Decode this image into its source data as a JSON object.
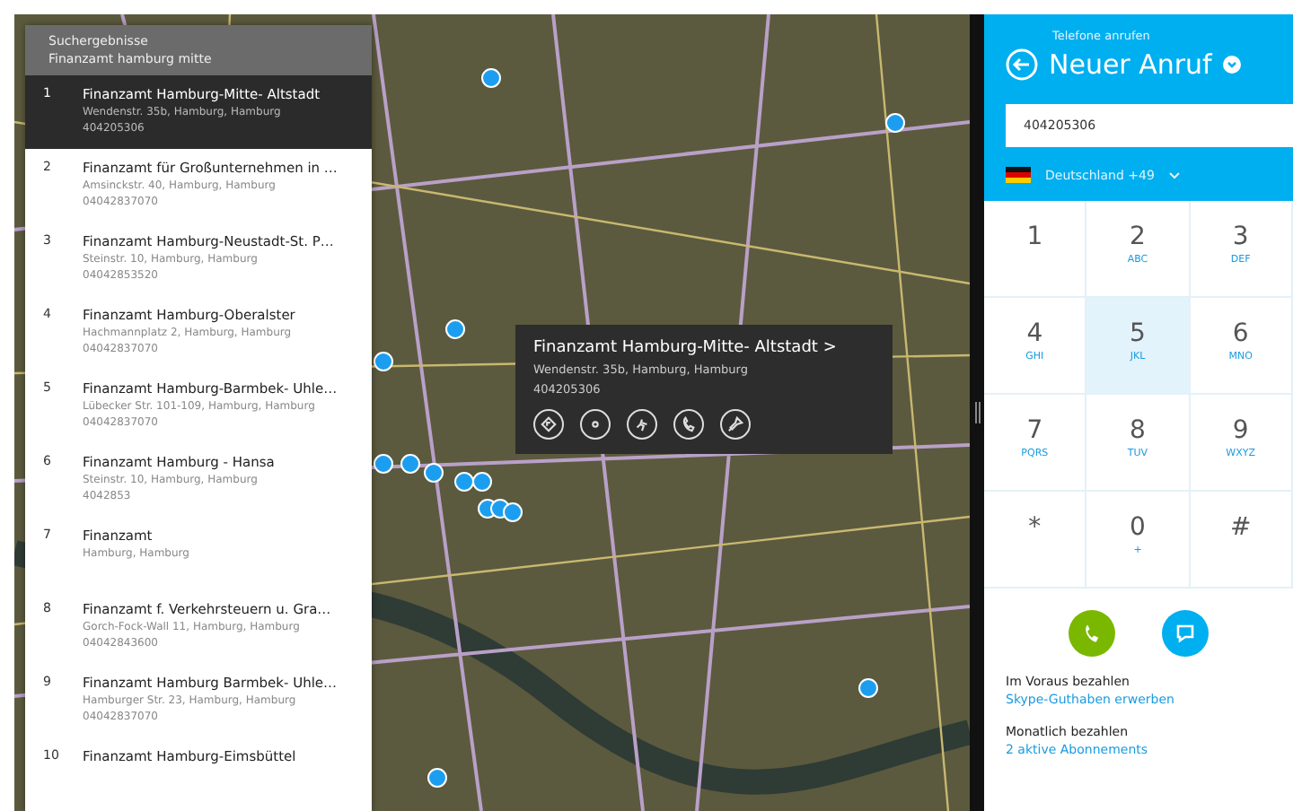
{
  "search_results": {
    "title": "Suchergebnisse",
    "query": "Finanzamt hamburg mitte",
    "items": [
      {
        "number": "1",
        "name": "Finanzamt Hamburg-Mitte- Altstadt",
        "address": "Wendenstr. 35b, Hamburg, Hamburg",
        "phone": "404205306",
        "selected": true
      },
      {
        "number": "2",
        "name": "Finanzamt für Großunternehmen in …",
        "address": "Amsinckstr. 40, Hamburg, Hamburg",
        "phone": "04042837070",
        "selected": false
      },
      {
        "number": "3",
        "name": "Finanzamt Hamburg-Neustadt-St. P…",
        "address": "Steinstr. 10, Hamburg, Hamburg",
        "phone": "04042853520",
        "selected": false
      },
      {
        "number": "4",
        "name": "Finanzamt Hamburg-Oberalster",
        "address": "Hachmannplatz 2, Hamburg, Hamburg",
        "phone": "04042837070",
        "selected": false
      },
      {
        "number": "5",
        "name": "Finanzamt Hamburg-Barmbek- Uhle…",
        "address": "Lübecker Str. 101-109, Hamburg, Hamburg",
        "phone": "04042837070",
        "selected": false
      },
      {
        "number": "6",
        "name": "Finanzamt Hamburg - Hansa",
        "address": "Steinstr. 10, Hamburg, Hamburg",
        "phone": "4042853",
        "selected": false
      },
      {
        "number": "7",
        "name": "Finanzamt",
        "address": "Hamburg, Hamburg",
        "selected": false
      },
      {
        "number": "8",
        "name": "Finanzamt f. Verkehrsteuern u. Gra…",
        "address": "Gorch-Fock-Wall 11, Hamburg, Hamburg",
        "phone": "04042843600",
        "selected": false
      },
      {
        "number": "9",
        "name": "Finanzamt Hamburg Barmbek- Uhle…",
        "address": "Hamburger Str. 23, Hamburg, Hamburg",
        "phone": "04042837070",
        "selected": false
      },
      {
        "number": "10",
        "name": "Finanzamt Hamburg-Eimsbüttel",
        "selected": false
      }
    ]
  },
  "map": {
    "popup": {
      "title": "Finanzamt Hamburg-Mitte- Altstadt",
      "chevron": ">",
      "address": "Wendenstr. 35b, Hamburg, Hamburg",
      "phone": "404205306"
    }
  },
  "dialer": {
    "subtitle": "Telefone anrufen",
    "title": "Neuer Anruf",
    "number": "404205306",
    "country": "Deutschland +49",
    "keys": [
      {
        "digit": "1",
        "selected": false
      },
      {
        "digit": "2",
        "letters": "ABC",
        "selected": false
      },
      {
        "digit": "3",
        "letters": "DEF",
        "selected": false
      },
      {
        "digit": "4",
        "letters": "GHI",
        "selected": false
      },
      {
        "digit": "5",
        "letters": "JKL",
        "selected": true
      },
      {
        "digit": "6",
        "letters": "MNO",
        "selected": false
      },
      {
        "digit": "7",
        "letters": "PQRS",
        "selected": false
      },
      {
        "digit": "8",
        "letters": "TUV",
        "selected": false
      },
      {
        "digit": "9",
        "letters": "WXYZ",
        "selected": false
      },
      {
        "digit": "*",
        "selected": false
      },
      {
        "digit": "0",
        "letters": "+",
        "selected": false
      },
      {
        "digit": "#",
        "selected": false
      }
    ],
    "billing": [
      {
        "label": "Im Voraus bezahlen",
        "link": "Skype-Guthaben erwerben"
      },
      {
        "label": "Monatlich bezahlen",
        "link": "2 aktive Abonnements"
      }
    ]
  }
}
